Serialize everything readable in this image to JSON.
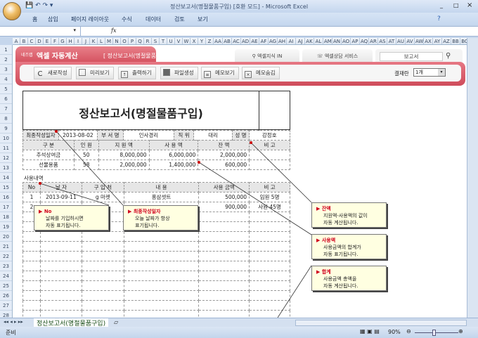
{
  "window": {
    "title": "정산보고서(명절물품구입)  [호환 모드] - Microsoft Excel",
    "controls": [
      "_",
      "□",
      "×"
    ]
  },
  "ribbon_tabs": [
    "홈",
    "삽입",
    "페이지 레이아웃",
    "수식",
    "데이터",
    "검토",
    "보기"
  ],
  "formula_bar": {
    "fx": "fx",
    "value": ""
  },
  "columns": [
    "A",
    "B",
    "C",
    "D",
    "E",
    "F",
    "G",
    "H",
    "I",
    "J",
    "K",
    "L",
    "M",
    "N",
    "O",
    "P",
    "Q",
    "R",
    "S",
    "T",
    "U",
    "V",
    "W",
    "X",
    "Y",
    "Z",
    "AA",
    "AB",
    "AC",
    "AD",
    "AE",
    "AF",
    "AG",
    "AH",
    "AI",
    "AJ",
    "AK",
    "AL",
    "AM",
    "AN",
    "AO",
    "AP",
    "AQ",
    "AR",
    "AS",
    "AT",
    "AU",
    "AV",
    "AW",
    "AX",
    "AY",
    "AZ",
    "BB",
    "BC"
  ],
  "rows": [
    "1",
    "2",
    "3",
    "4",
    "5",
    "6",
    "7",
    "8",
    "9",
    "10",
    "11",
    "12",
    "13",
    "14",
    "15",
    "16",
    "17",
    "18",
    "19",
    "20",
    "21",
    "22",
    "23",
    "24",
    "25",
    "26",
    "27",
    "28"
  ],
  "banner": {
    "brand_small": "네즈랩",
    "brand": "엑셀 자동계산",
    "subtitle": "[ 정산보고서(명절물품구입) ]",
    "nav": [
      "엑셀지식 IN",
      "엑셀상담 서비스"
    ],
    "search_value": "보고서",
    "tools": [
      "새로작성",
      "미리보기",
      "출력하기",
      "파일생성",
      "메모보기",
      "메모숨김"
    ],
    "result_label": "결재란",
    "result_value": "1개"
  },
  "report": {
    "title": "정산보고서(명절물품구입)",
    "info": {
      "date_label": "최종작성일자",
      "date": "2013-08-02",
      "dept_label": "부 서 명",
      "dept": "인사경리",
      "pos_label": "직  위",
      "pos": "대리",
      "name_label": "성  명",
      "name": "강정호"
    },
    "summary_headers": [
      "구  분",
      "인 원",
      "지 원 액",
      "사 용 액",
      "잔  액",
      "비  고"
    ],
    "summary_rows": [
      [
        "추석상여금",
        "50",
        "8,000,000",
        "6,000,000",
        "2,000,000",
        ""
      ],
      [
        "선물용품",
        "58",
        "2,000,000",
        "1,400,000",
        "600,000",
        ""
      ]
    ],
    "usage_label": "사용내역",
    "usage_headers": [
      "No",
      "날  자",
      "구 입 처",
      "내  용",
      "사용 금액",
      "비  고"
    ],
    "usage_rows": [
      [
        "1",
        "2013-09-11",
        "g 마켓",
        "홍삼셋트",
        "500,000",
        "임원 5명"
      ],
      [
        "2",
        "",
        "",
        "",
        "900,000",
        "사원 45명"
      ]
    ]
  },
  "callouts": [
    {
      "title": "No",
      "lines": [
        "날짜를 기입하시면",
        "자동 표기됩니다."
      ]
    },
    {
      "title": "최종작성일자",
      "lines": [
        "오늘 날짜가 항상",
        "표기됩니다."
      ]
    },
    {
      "title": "잔액",
      "lines": [
        "지원액-사용액의 값이",
        "자동 계산됩니다."
      ]
    },
    {
      "title": "사용액",
      "lines": [
        "사용금액의 합계가",
        "자동 표기됩니다."
      ]
    },
    {
      "title": "합계",
      "lines": [
        "사용금액 총액을",
        "자동 계산됩니다."
      ]
    }
  ],
  "sheet_tab": "정산보고서(명절물품구입)",
  "status": {
    "ready": "준비",
    "zoom": "90%"
  }
}
